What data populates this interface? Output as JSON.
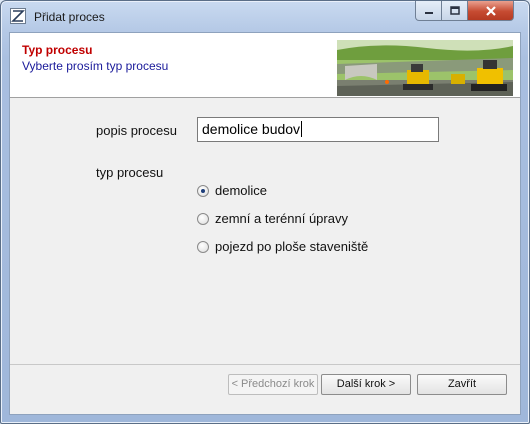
{
  "window": {
    "title": "Přidat proces"
  },
  "header": {
    "title": "Typ procesu",
    "subtitle": "Vyberte prosím typ procesu"
  },
  "form": {
    "description_label": "popis procesu",
    "description_value": "demolice budov",
    "type_label": "typ procesu",
    "options": [
      {
        "label": "demolice",
        "selected": true
      },
      {
        "label": "zemní a terénní úpravy",
        "selected": false
      },
      {
        "label": "pojezd po ploše staveniště",
        "selected": false
      }
    ]
  },
  "buttons": {
    "prev": "< Předchozí krok",
    "next": "Další krok >",
    "close": "Zavřít"
  },
  "colors": {
    "header_title": "#c00000",
    "header_subtitle": "#1a1a9a",
    "close_button": "#c64b32"
  }
}
